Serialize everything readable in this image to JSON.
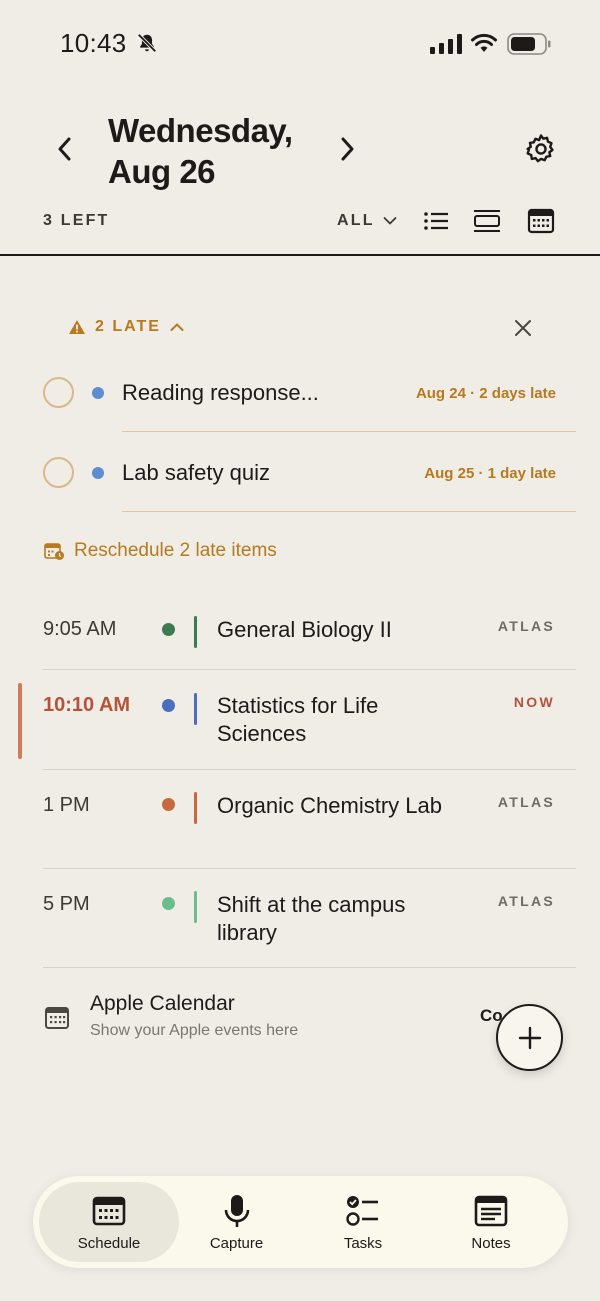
{
  "status_bar": {
    "time": "10:43"
  },
  "header": {
    "date_line1": "Wednesday,",
    "date_line2": "Aug 26",
    "left_count": "3 LEFT",
    "filter_label": "ALL"
  },
  "late_section": {
    "label": "2 LATE",
    "items": [
      {
        "title": "Reading response...",
        "meta": "Aug 24 · 2 days late",
        "dot_color": "#5b8fd1"
      },
      {
        "title": "Lab safety quiz",
        "meta": "Aug 25 · 1 day late",
        "dot_color": "#5b8fd1"
      }
    ],
    "reschedule_label": "Reschedule 2 late items"
  },
  "events": [
    {
      "time": "9:05 AM",
      "title": "General Biology II",
      "tag": "ATLAS",
      "color": "#3e7a4f"
    },
    {
      "time": "10:10 AM",
      "title": "Statistics for Life Sciences",
      "tag": "NOW",
      "color": "#4a6fc0"
    },
    {
      "time": "1 PM",
      "title": "Organic Chemistry Lab",
      "tag": "ATLAS",
      "color": "#c7693f"
    },
    {
      "time": "5 PM",
      "title": "Shift at the campus library",
      "tag": "ATLAS",
      "color": "#6dbd8a"
    }
  ],
  "apple_calendar": {
    "title": "Apple Calendar",
    "subtitle": "Show your Apple events here",
    "connect_label": "Co"
  },
  "tabs": [
    {
      "label": "Schedule",
      "icon": "calendar-grid-icon",
      "active": true
    },
    {
      "label": "Capture",
      "icon": "microphone-icon"
    },
    {
      "label": "Tasks",
      "icon": "checklist-icon"
    },
    {
      "label": "Notes",
      "icon": "notes-icon"
    }
  ],
  "colors": {
    "accent": "#b77a1e",
    "now": "#b4533a",
    "background": "#efede6"
  }
}
